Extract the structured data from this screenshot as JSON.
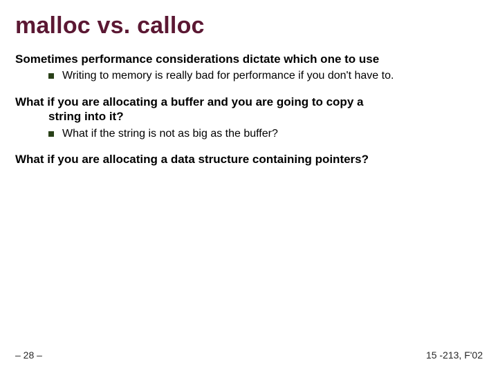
{
  "title": "malloc vs. calloc",
  "blocks": [
    {
      "heading": "Sometimes performance considerations dictate which one to use",
      "heading_cont": "",
      "bullets": [
        "Writing to memory is really bad for performance if you don't have to."
      ]
    },
    {
      "heading": "What if you are allocating a buffer and you are going to copy a",
      "heading_cont": "string into it?",
      "bullets": [
        "What if the string is not as big as the buffer?"
      ]
    },
    {
      "heading": "What if you are allocating a data structure containing pointers?",
      "heading_cont": "",
      "bullets": []
    }
  ],
  "footer": {
    "left": "– 28 –",
    "right": "15 -213, F'02"
  }
}
